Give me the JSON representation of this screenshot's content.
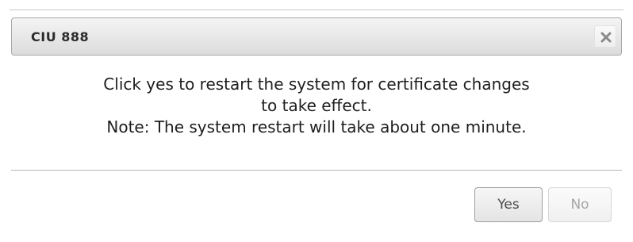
{
  "dialog": {
    "title": "CIU 888",
    "close_icon": "close-icon",
    "message_lines": [
      "Click yes to restart the system for certificate changes",
      "to take effect.",
      "Note: The system restart will take about one minute."
    ],
    "buttons": {
      "yes_label": "Yes",
      "no_label": "No"
    }
  },
  "colors": {
    "titlebar_border": "#a9a9a9",
    "text": "#1e1e1e",
    "disabled_text": "#a6a6a6"
  }
}
